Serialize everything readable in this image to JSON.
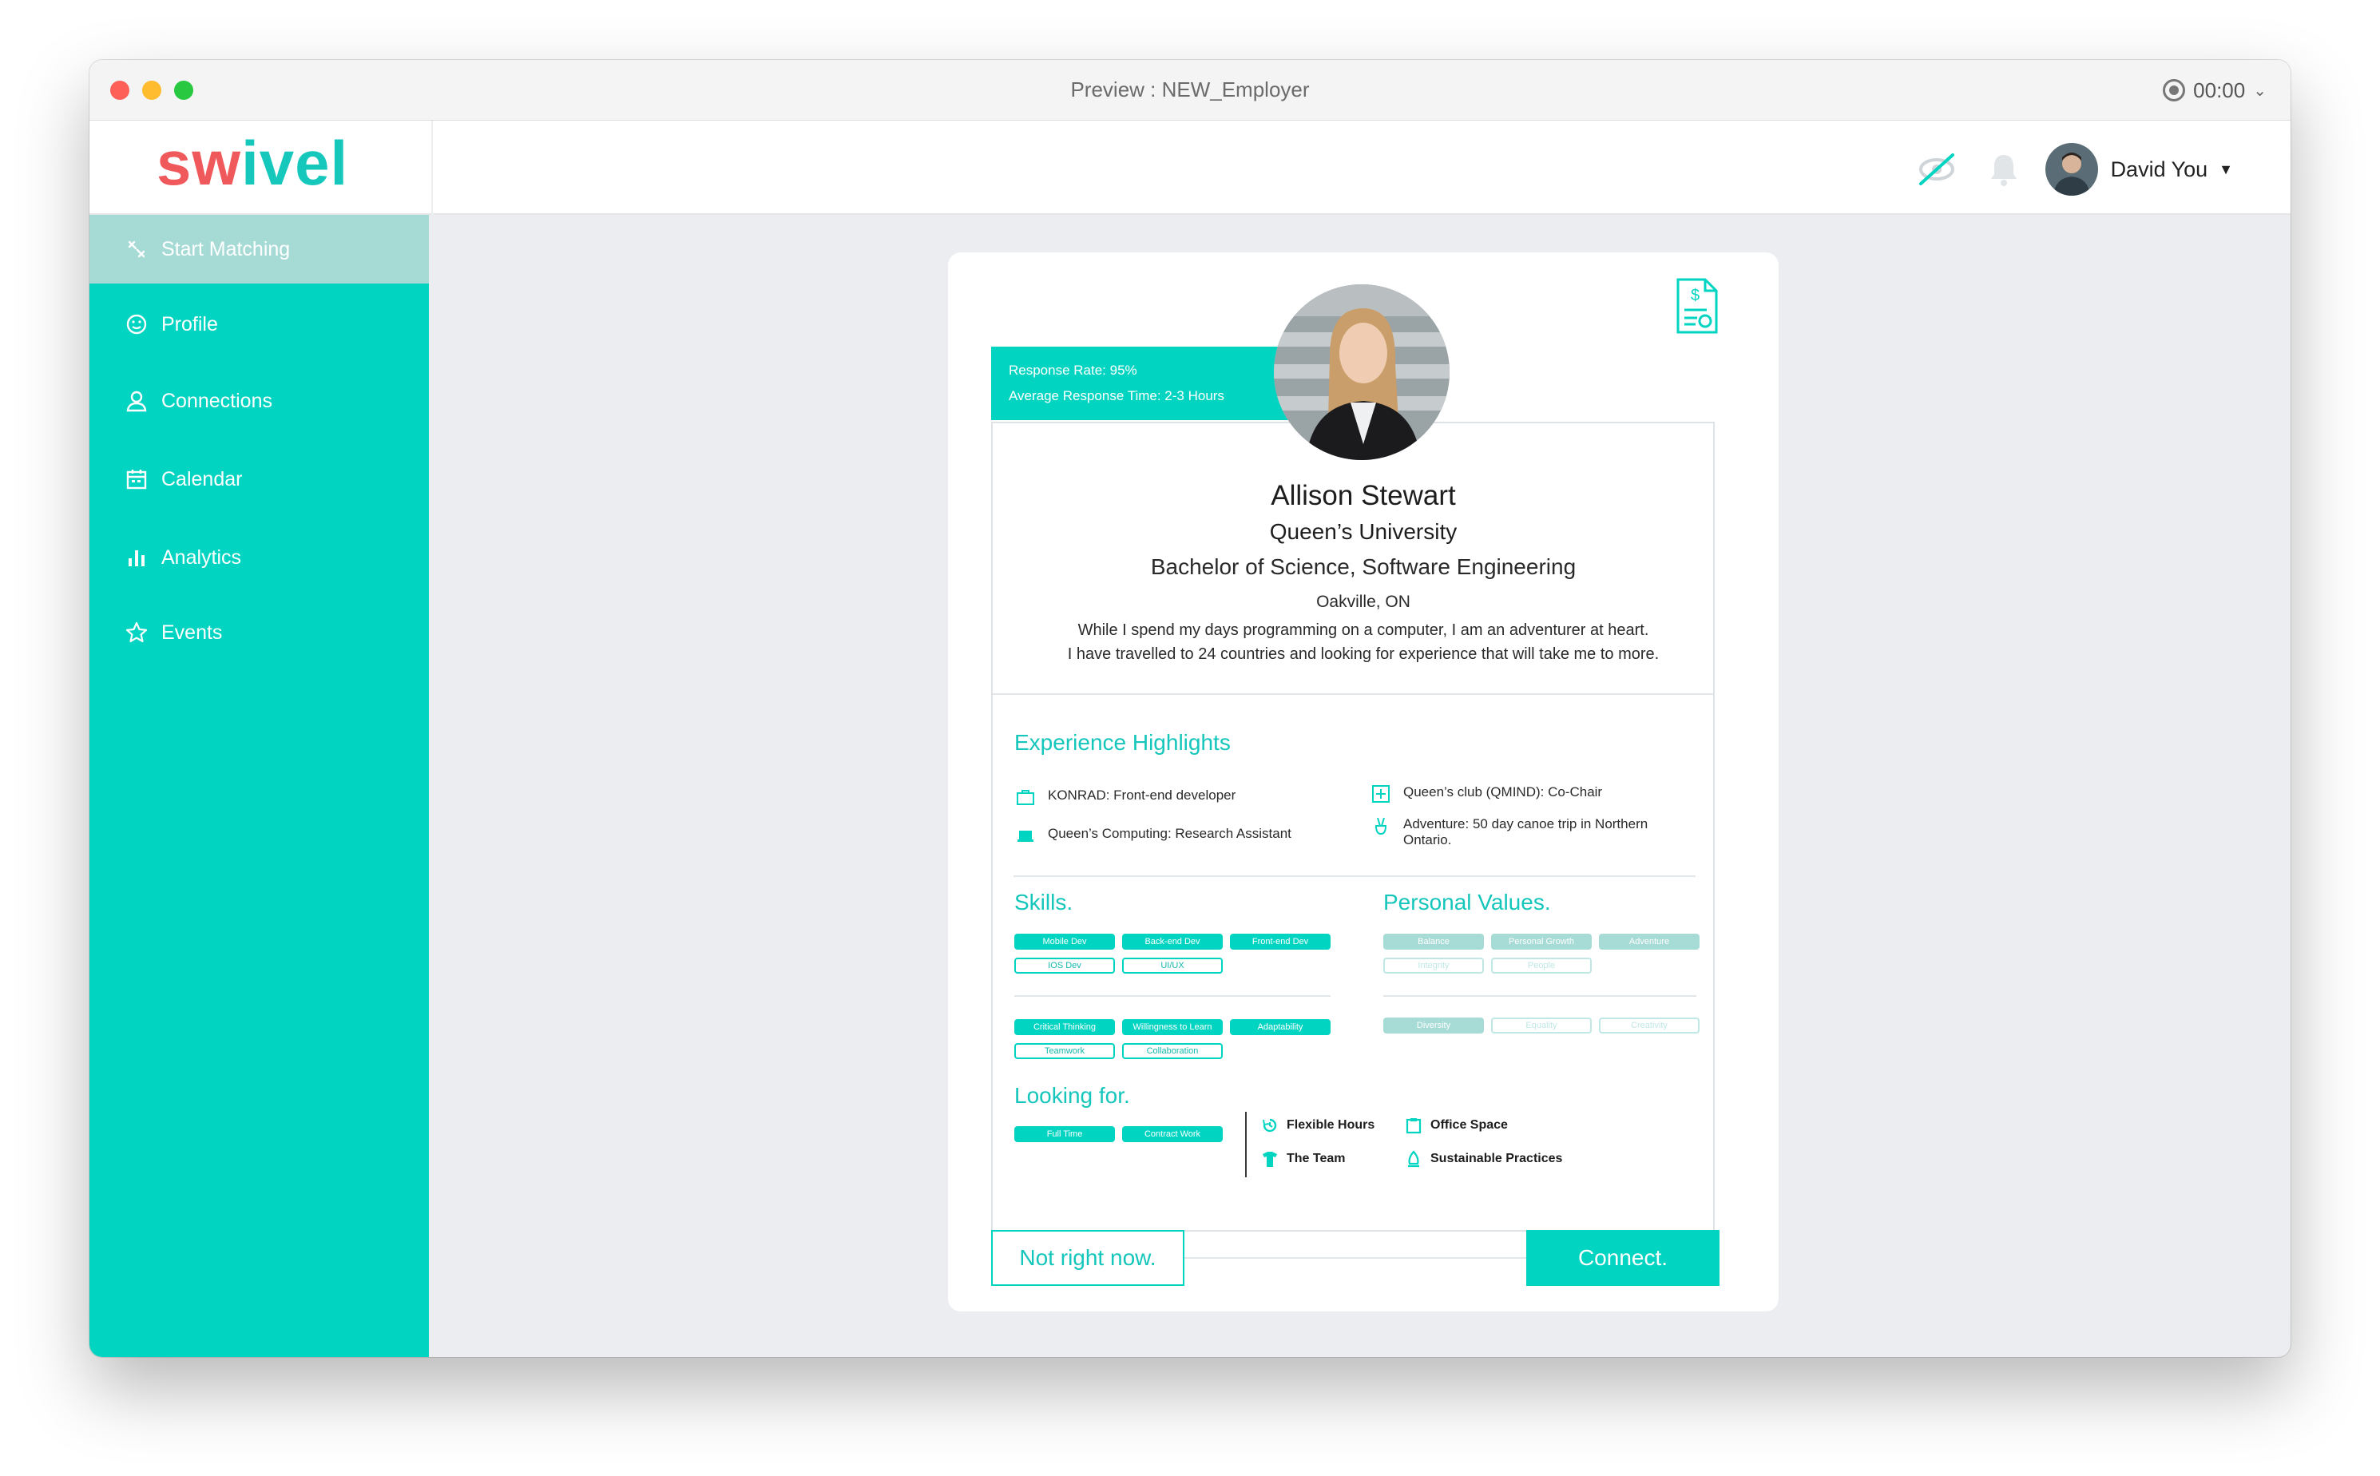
{
  "window": {
    "title": "Preview : NEW_Employer",
    "timer": "00:00"
  },
  "brand": {
    "logo_part1": "sw",
    "logo_dot": "i",
    "logo_part2": "vel",
    "primary_color": "#02d4c2",
    "accent_color": "#f0595b"
  },
  "header": {
    "user_name": "David You"
  },
  "sidebar": {
    "items": [
      {
        "label": "Start Matching",
        "icon": "matching-icon",
        "active": true
      },
      {
        "label": "Profile",
        "icon": "smiley-icon"
      },
      {
        "label": "Connections",
        "icon": "person-icon"
      },
      {
        "label": "Calendar",
        "icon": "calendar-icon"
      },
      {
        "label": "Analytics",
        "icon": "bar-chart-icon"
      },
      {
        "label": "Events",
        "icon": "star-icon"
      }
    ]
  },
  "candidate": {
    "response_rate": "Response Rate: 95%",
    "response_time": "Average Response Time: 2-3 Hours",
    "name": "Allison Stewart",
    "school": "Queen’s University",
    "degree": "Bachelor of Science, Software Engineering",
    "location": "Oakville, ON",
    "bio_line1": "While I spend my days programming on a computer, I am an adventurer at heart.",
    "bio_line2": "I have travelled to 24 countries and looking for experience that will take me to more."
  },
  "experience": {
    "title": "Experience Highlights",
    "items": [
      "KONRAD: Front-end developer",
      "Queen’s Computing: Research Assistant",
      "Queen’s club (QMIND): Co-Chair",
      "Adventure: 50 day canoe trip in Northern Ontario."
    ]
  },
  "skills": {
    "title": "Skills.",
    "technical": [
      "Mobile Dev",
      "Back-end Dev",
      "Front-end Dev",
      "IOS Dev",
      "UI/UX"
    ],
    "soft": [
      "Critical Thinking",
      "Willingness to Learn",
      "Adaptability",
      "Teamwork",
      "Collaboration"
    ]
  },
  "values": {
    "title": "Personal Values.",
    "row1": [
      "Balance",
      "Personal Growth",
      "Adventure",
      "Integrity",
      "People"
    ],
    "row2": [
      "Diversity",
      "Equality",
      "Creativity"
    ]
  },
  "looking_for": {
    "title": "Looking for.",
    "types": [
      "Full Time",
      "Contract Work"
    ],
    "perks": [
      "Flexible Hours",
      "Office Space",
      "The Team",
      "Sustainable Practices"
    ]
  },
  "actions": {
    "decline": "Not right now.",
    "connect": "Connect."
  }
}
